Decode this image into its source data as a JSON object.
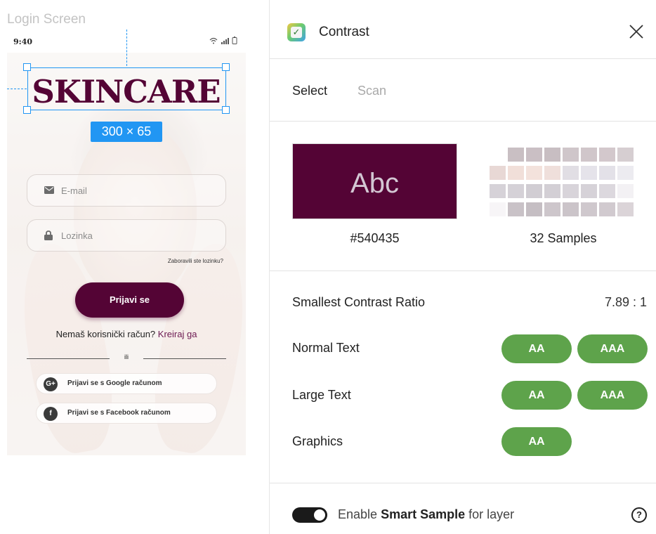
{
  "canvas": {
    "frame_label": "Login Screen",
    "status_bar": {
      "time": "9:40",
      "icons": "wifi signal battery"
    },
    "logo_text": "SKINCARE",
    "selection_size": "300 × 65",
    "email": {
      "icon": "mail-icon",
      "placeholder": "E-mail"
    },
    "password": {
      "icon": "lock-icon",
      "placeholder": "Lozinka"
    },
    "forgot_link": "Zaboravili ste lozinku?",
    "login_button": "Prijavi se",
    "register_prefix": "Nemaš korisnički račun?",
    "register_link": "Kreiraj ga",
    "divider_text": "ili",
    "google_button": {
      "icon": "google-icon",
      "label": "Prijavi se s Google računom"
    },
    "facebook_button": {
      "icon": "facebook-icon",
      "label": "Prijavi se s Facebook računom"
    },
    "brand_color": "#540435",
    "selection_color": "#2196f3"
  },
  "panel": {
    "title": "Contrast",
    "app_icon": "checkmark-icon",
    "close_icon": "close-icon",
    "tabs": [
      {
        "label": "Select",
        "active": true
      },
      {
        "label": "Scan",
        "active": false
      }
    ],
    "swatch": {
      "text": "Abc",
      "hex": "#540435"
    },
    "samples": {
      "label": "32 Samples",
      "colors": [
        "#c9bfc3",
        "#cabfc4",
        "#c8bec2",
        "#cfc6ca",
        "#d0c6ca",
        "#d3c8cc",
        "#d6ced1",
        "#e8d8d5",
        "#f1dfd9",
        "#f3e2dc",
        "#efdfdb",
        "#e1dee4",
        "#e5e3ea",
        "#e3e1e8",
        "#ecebf0",
        "#d6d2d8",
        "#d5d1d7",
        "#d1cdd3",
        "#d3cfd5",
        "#d8d4da",
        "#d6d2d8",
        "#dcd8de",
        "#f3f1f4",
        "#f7f5f7",
        "#c9c2c7",
        "#c5bec3",
        "#cdc6cb",
        "#cbc4c9",
        "#cfc8cd",
        "#d1cacf",
        "#dbd4d8",
        "#e0dadd"
      ]
    },
    "results": {
      "smallest_ratio_label": "Smallest Contrast Ratio",
      "smallest_ratio_value": "7.89 : 1",
      "normal_text": {
        "label": "Normal Text",
        "badges": [
          "AA",
          "AAA"
        ]
      },
      "large_text": {
        "label": "Large Text",
        "badges": [
          "AA",
          "AAA"
        ]
      },
      "graphics": {
        "label": "Graphics",
        "badges": [
          "AA"
        ]
      },
      "pass_color": "#5ea34b"
    },
    "footer": {
      "toggle_on": true,
      "prefix": "Enable ",
      "bold": "Smart Sample",
      "suffix": " for layer",
      "help_icon": "help-icon"
    }
  }
}
